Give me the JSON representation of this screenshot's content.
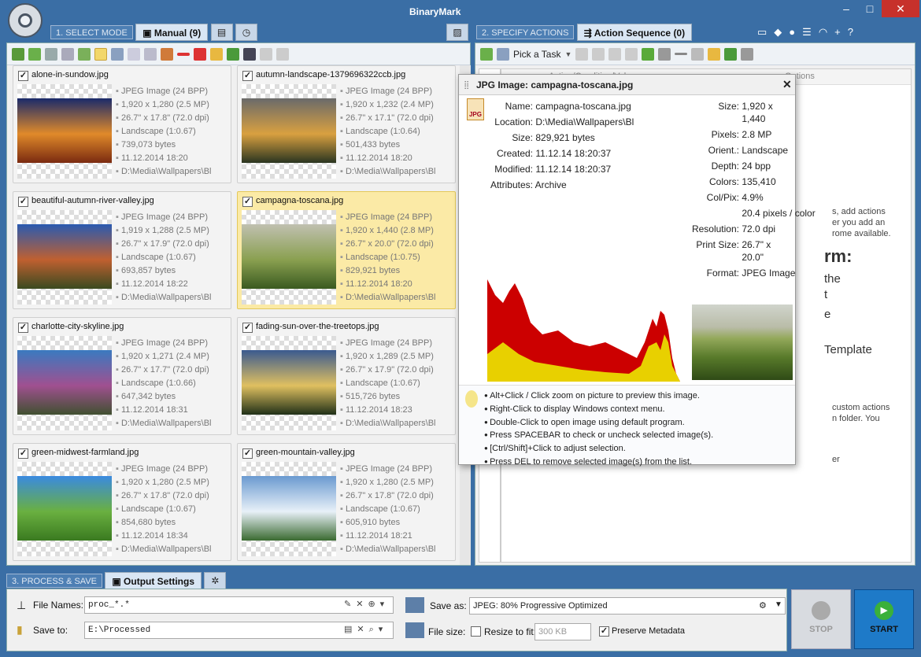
{
  "app": {
    "brand": "BinaryMark"
  },
  "window": {
    "minimize": "–",
    "maximize": "□",
    "close": "✕"
  },
  "mode": {
    "step": "1. SELECT MODE",
    "tab": "Manual (9)"
  },
  "actions": {
    "step": "2. SPECIFY ACTIONS",
    "tab": "Action Sequence (0)",
    "pick_task": "Pick a Task",
    "column_fragment": "Action/Condition/Value",
    "column_fragment2": "Options"
  },
  "images": [
    {
      "name": "alone-in-sundow.jpg",
      "type": "JPEG Image (24 BPP)",
      "dims": "1,920 x 1,280 (2.5 MP)",
      "print": "26.7\" x 17.8\" (72.0 dpi)",
      "orient": "Landscape (1:0.67)",
      "bytes": "739,073 bytes",
      "date": "11.12.2014 18:20",
      "path": "D:\\Media\\Wallpapers\\Bl",
      "selected": false,
      "checked": true,
      "colors": [
        "#1a2a6a",
        "#e08a2a",
        "#7a2a10"
      ]
    },
    {
      "name": "autumn-landscape-1379696322ccb.jpg",
      "type": "JPEG Image (24 BPP)",
      "dims": "1,920 x 1,232 (2.4 MP)",
      "print": "26.7\" x 17.1\" (72.0 dpi)",
      "orient": "Landscape (1:0.64)",
      "bytes": "501,433 bytes",
      "date": "11.12.2014 18:20",
      "path": "D:\\Media\\Wallpapers\\Bl",
      "selected": false,
      "checked": true,
      "colors": [
        "#6a6a6a",
        "#d9a040",
        "#2a3520"
      ]
    },
    {
      "name": "beautiful-autumn-river-valley.jpg",
      "type": "JPEG Image (24 BPP)",
      "dims": "1,919 x 1,288 (2.5 MP)",
      "print": "26.7\" x 17.9\" (72.0 dpi)",
      "orient": "Landscape (1:0.67)",
      "bytes": "693,857 bytes",
      "date": "11.12.2014 18:22",
      "path": "D:\\Media\\Wallpapers\\Bl",
      "selected": false,
      "checked": true,
      "colors": [
        "#2a5ab0",
        "#c06030",
        "#3a4a20"
      ]
    },
    {
      "name": "campagna-toscana.jpg",
      "type": "JPEG Image (24 BPP)",
      "dims": "1,920 x 1,440 (2.8 MP)",
      "print": "26.7\" x 20.0\" (72.0 dpi)",
      "orient": "Landscape (1:0.75)",
      "bytes": "829,921 bytes",
      "date": "11.12.2014 18:20",
      "path": "D:\\Media\\Wallpapers\\Bl",
      "selected": true,
      "checked": true,
      "colors": [
        "#c0c0b0",
        "#8aa050",
        "#3a5a20"
      ]
    },
    {
      "name": "charlotte-city-skyline.jpg",
      "type": "JPEG Image (24 BPP)",
      "dims": "1,920 x 1,271 (2.4 MP)",
      "print": "26.7\" x 17.7\" (72.0 dpi)",
      "orient": "Landscape (1:0.66)",
      "bytes": "647,342 bytes",
      "date": "11.12.2014 18:31",
      "path": "D:\\Media\\Wallpapers\\Bl",
      "selected": false,
      "checked": true,
      "colors": [
        "#3a7ac0",
        "#a05090",
        "#405030"
      ]
    },
    {
      "name": "fading-sun-over-the-treetops.jpg",
      "type": "JPEG Image (24 BPP)",
      "dims": "1,920 x 1,289 (2.5 MP)",
      "print": "26.7\" x 17.9\" (72.0 dpi)",
      "orient": "Landscape (1:0.67)",
      "bytes": "515,726 bytes",
      "date": "11.12.2014 18:23",
      "path": "D:\\Media\\Wallpapers\\Bl",
      "selected": false,
      "checked": true,
      "colors": [
        "#3a5a90",
        "#e0c060",
        "#203018"
      ]
    },
    {
      "name": "green-midwest-farmland.jpg",
      "type": "JPEG Image (24 BPP)",
      "dims": "1,920 x 1,280 (2.5 MP)",
      "print": "26.7\" x 17.8\" (72.0 dpi)",
      "orient": "Landscape (1:0.67)",
      "bytes": "854,680 bytes",
      "date": "11.12.2014 18:34",
      "path": "D:\\Media\\Wallpapers\\Bl",
      "selected": false,
      "checked": true,
      "colors": [
        "#3a8ae0",
        "#6ab040",
        "#3a7a20"
      ]
    },
    {
      "name": "green-mountain-valley.jpg",
      "type": "JPEG Image (24 BPP)",
      "dims": "1,920 x 1,280 (2.5 MP)",
      "print": "26.7\" x 17.8\" (72.0 dpi)",
      "orient": "Landscape (1:0.67)",
      "bytes": "605,910 bytes",
      "date": "11.12.2014 18:21",
      "path": "D:\\Media\\Wallpapers\\Bl",
      "selected": false,
      "checked": true,
      "colors": [
        "#6a9ad0",
        "#e8f0f8",
        "#3a6a30"
      ]
    }
  ],
  "popup": {
    "title": "JPG Image: campagna-toscana.jpg",
    "left": [
      [
        "Name:",
        "campagna-toscana.jpg"
      ],
      [
        "Location:",
        "D:\\Media\\Wallpapers\\Bl"
      ],
      [
        "Size:",
        "829,921 bytes"
      ],
      [
        "Created:",
        "11.12.14 18:20:37"
      ],
      [
        "Modified:",
        "11.12.14 18:20:37"
      ],
      [
        "Attributes:",
        "Archive"
      ]
    ],
    "right": [
      [
        "Size:",
        "1,920 x"
      ],
      [
        "",
        "1,440"
      ],
      [
        "Pixels:",
        "2.8 MP"
      ],
      [
        "Orient.:",
        "Landscape"
      ],
      [
        "Depth:",
        "24 bpp"
      ],
      [
        "Colors:",
        "135,410"
      ],
      [
        "Col/Pix:",
        "4.9%"
      ],
      [
        "",
        "20.4 pixels / color"
      ],
      [
        "Resolution:",
        "72.0 dpi"
      ],
      [
        "Print Size:",
        "26.7\" x"
      ],
      [
        "",
        "20.0\""
      ],
      [
        "Format:",
        "JPEG Image"
      ]
    ],
    "tips": [
      "Alt+Click / Click zoom on picture to preview this image.",
      "Right-Click to display Windows context menu.",
      "Double-Click to open image using default program.",
      "Press SPACEBAR to check or uncheck selected image(s).",
      "[Ctrl/Shift]+Click to adjust selection.",
      "Press DEL to remove selected image(s) from the list."
    ]
  },
  "bg_text": {
    "t1": "s, add actions",
    "t2": "er you add an",
    "t3": "rome available.",
    "t4": "rm:",
    "t5": "the",
    "t6": "t",
    "t7": "e",
    "t8": "Template",
    "t9": "custom actions",
    "t10": "n folder. You",
    "t11": "er"
  },
  "output": {
    "step": "3. PROCESS & SAVE",
    "tab": "Output Settings",
    "file_names_label": "File Names:",
    "file_names_value": "proc_*.*",
    "save_to_label": "Save to:",
    "save_to_value": "E:\\Processed",
    "save_as_label": "Save as:",
    "save_as_value": "JPEG: 80%  Progressive Optimized",
    "file_size_label": "File size:",
    "resize_label": "Resize to fit:",
    "resize_value": "300 KB",
    "preserve_label": "Preserve Metadata",
    "stop": "STOP",
    "start": "START"
  },
  "colors": {
    "accent": "#3a6ea5",
    "selected": "#fbeaa6",
    "start": "#1e7ac8"
  }
}
